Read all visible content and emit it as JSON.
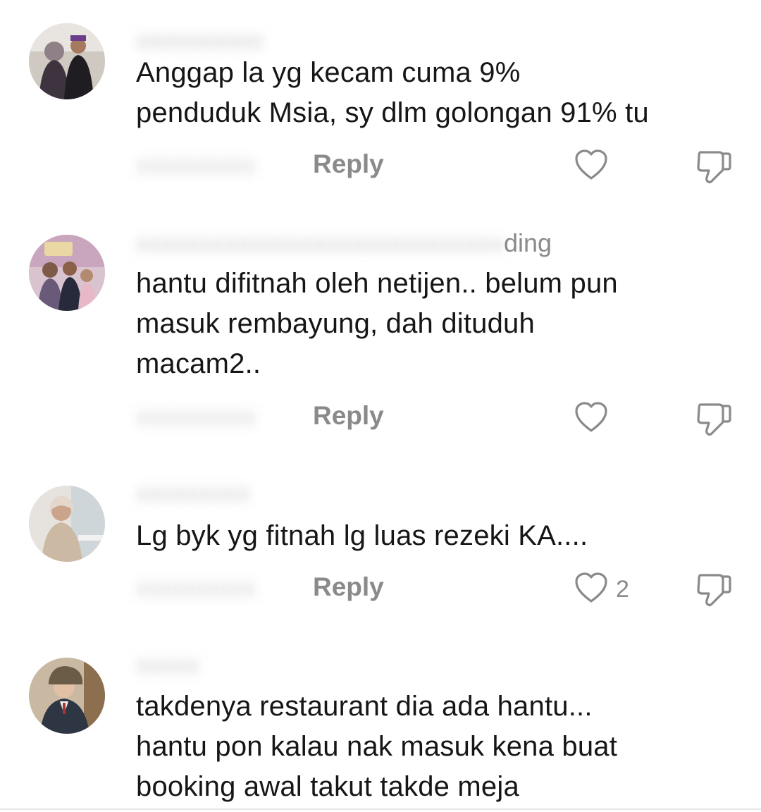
{
  "comments": [
    {
      "username": "",
      "text": "Anggap la yg kecam cuma 9%\npenduduk Msia, sy dlm golongan 91% tu",
      "reply_label": "Reply",
      "likes": ""
    },
    {
      "username": "ding",
      "text": "hantu difitnah oleh netijen.. belum pun\nmasuk rembayung, dah dituduh\nmacam2..",
      "reply_label": "Reply",
      "likes": ""
    },
    {
      "username": "",
      "text": "Lg byk yg fitnah lg luas rezeki KA....",
      "reply_label": "Reply",
      "likes": "2"
    },
    {
      "username": "",
      "text": "takdenya restaurant dia ada hantu...\nhantu pon kalau nak masuk kena buat\nbooking awal takut takde meja",
      "reply_label": "",
      "likes": ""
    }
  ],
  "icons": {
    "like": "heart-outline-icon",
    "dislike": "thumbs-down-outline-icon"
  },
  "colors": {
    "text": "#161616",
    "muted": "#8a8a8a",
    "background": "#ffffff"
  }
}
